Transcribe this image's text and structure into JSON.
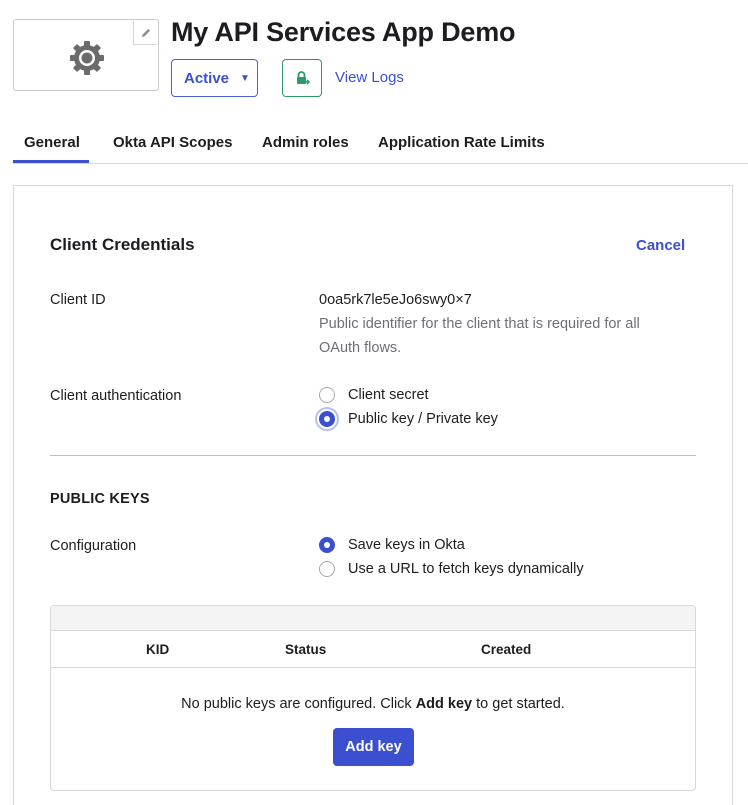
{
  "header": {
    "title": "My API Services App Demo",
    "status_label": "Active",
    "status_caret": "▼",
    "view_logs_label": "View Logs",
    "app_icon": "gear-icon",
    "edit_icon": "pencil-icon",
    "push_icon": "lock-push-icon"
  },
  "tabs": [
    {
      "label": "General",
      "active": true
    },
    {
      "label": "Okta API Scopes",
      "active": false
    },
    {
      "label": "Admin roles",
      "active": false
    },
    {
      "label": "Application Rate Limits",
      "active": false
    }
  ],
  "client_credentials": {
    "title": "Client Credentials",
    "cancel_label": "Cancel",
    "client_id_label": "Client ID",
    "client_id_value": "0oa5rk7le5eJo6swy0×7",
    "client_id_help": "Public identifier for the client that is required for all OAuth flows.",
    "client_auth_label": "Client authentication",
    "client_auth_options": [
      {
        "label": "Client secret",
        "checked": false
      },
      {
        "label": "Public key / Private key",
        "checked": true
      }
    ]
  },
  "public_keys": {
    "title": "PUBLIC KEYS",
    "configuration_label": "Configuration",
    "configuration_options": [
      {
        "label": "Save keys in Okta",
        "checked": true
      },
      {
        "label": "Use a URL to fetch keys dynamically",
        "checked": false
      }
    ],
    "table": {
      "columns": [
        "KID",
        "Status",
        "Created"
      ],
      "empty_prefix": "No public keys are configured. Click ",
      "empty_bold": "Add key",
      "empty_suffix": " to get started.",
      "add_key_label": "Add key"
    }
  },
  "colors": {
    "accent": "#3b4fd1",
    "push_green": "#2c9a6a"
  }
}
